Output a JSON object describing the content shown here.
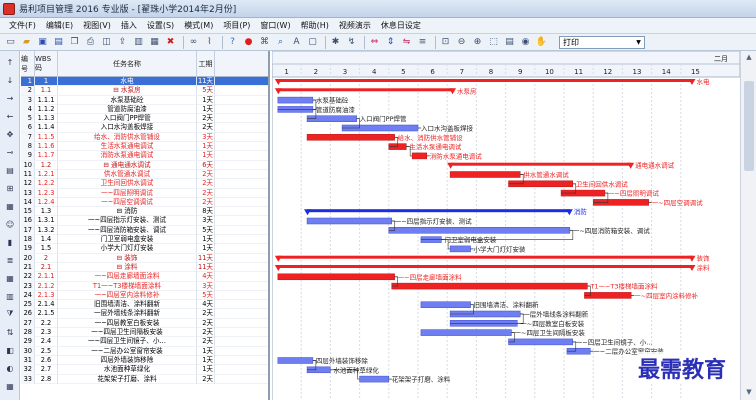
{
  "window": {
    "title": "易利项目管理 2016 专业版 - [翟珠小学2014年2月份]"
  },
  "menu": [
    "文件(F)",
    "编辑(E)",
    "视图(V)",
    "插入",
    "设置(S)",
    "模式(M)",
    "项目(P)",
    "窗口(W)",
    "帮助(H)",
    "视频演示",
    "休息日设定"
  ],
  "toolbar": {
    "icons": [
      "new-file-icon",
      "open-folder-icon",
      "save-icon",
      "save-as-icon",
      "copy-icon",
      "print-icon",
      "print-preview-icon",
      "export-icon",
      "document-icon",
      "page-icon",
      "delete-x-icon",
      "link-icon",
      "unlink-icon",
      "help-icon",
      "stop-icon",
      "network-icon",
      "search-icon",
      "text-a-icon",
      "text-frame-icon",
      "settings-icon",
      "link-arrow-icon",
      "indent-left-icon",
      "indent-mid-icon",
      "indent-right-icon",
      "outline-icon",
      "zoom-fit-icon",
      "zoom-out-icon",
      "zoom-in-icon",
      "select-area-icon",
      "page-view-icon",
      "eye-icon",
      "hand-pan-icon"
    ],
    "zoom_value": "打印"
  },
  "left_tools": [
    "arrow-up-icon",
    "arrow-down-icon",
    "indent-icon",
    "outdent-icon",
    "move-icon",
    "link-task-icon",
    "gantt-icon",
    "network-view-icon",
    "calendar-icon",
    "resource-icon",
    "chart-icon",
    "list-icon",
    "table-icon",
    "report-icon",
    "filter-icon",
    "sort-icon",
    "layer-icon",
    "color-icon",
    "grid-icon"
  ],
  "grid": {
    "headers": {
      "no": "编号",
      "wbs": "WBS码",
      "name": "任务名称",
      "duration": "工期"
    },
    "rows": [
      {
        "no": "1",
        "wbs": "1",
        "name": "水电",
        "dur": "11天",
        "tone": "sum",
        "selected": true
      },
      {
        "no": "2",
        "wbs": "1.1",
        "name": "⊟ 水泵房",
        "dur": "5天",
        "tone": "sum"
      },
      {
        "no": "3",
        "wbs": "1.1.1",
        "name": "水泵基础砼",
        "dur": "1天",
        "tone": "normal"
      },
      {
        "no": "4",
        "wbs": "1.1.2",
        "name": "管道防腐油漆",
        "dur": "1天",
        "tone": "normal"
      },
      {
        "no": "5",
        "wbs": "1.1.3",
        "name": "入口阀门PP焊管",
        "dur": "2天",
        "tone": "normal"
      },
      {
        "no": "6",
        "wbs": "1.1.4",
        "name": "入口水沟盖板焊接",
        "dur": "2天",
        "tone": "normal"
      },
      {
        "no": "7",
        "wbs": "1.1.5",
        "name": "给水、消防供水管铺设",
        "dur": "3天",
        "tone": "red"
      },
      {
        "no": "8",
        "wbs": "1.1.6",
        "name": "生活水泵通电调试",
        "dur": "1天",
        "tone": "red"
      },
      {
        "no": "9",
        "wbs": "1.1.7",
        "name": "消防水泵通电调试",
        "dur": "1天",
        "tone": "red"
      },
      {
        "no": "10",
        "wbs": "1.2",
        "name": "⊟ 通电通水调试",
        "dur": "6天",
        "tone": "sum"
      },
      {
        "no": "11",
        "wbs": "1.2.1",
        "name": "供水管通水调试",
        "dur": "2天",
        "tone": "red"
      },
      {
        "no": "12",
        "wbs": "1.2.2",
        "name": "卫生间回供水调试",
        "dur": "2天",
        "tone": "red"
      },
      {
        "no": "13",
        "wbs": "1.2.3",
        "name": "一~四层照明调试",
        "dur": "2天",
        "tone": "red"
      },
      {
        "no": "14",
        "wbs": "1.2.4",
        "name": "一~四层空调调试",
        "dur": "2天",
        "tone": "red"
      },
      {
        "no": "15",
        "wbs": "1.3",
        "name": "⊟ 消防",
        "dur": "8天",
        "tone": "normal"
      },
      {
        "no": "16",
        "wbs": "1.3.1",
        "name": "一~四层指示灯安装、测试",
        "dur": "3天",
        "tone": "normal"
      },
      {
        "no": "17",
        "wbs": "1.3.2",
        "name": "一~四层消防箱安装、调试",
        "dur": "5天",
        "tone": "normal"
      },
      {
        "no": "18",
        "wbs": "1.4",
        "name": "门卫室弱电盒安装",
        "dur": "1天",
        "tone": "normal"
      },
      {
        "no": "19",
        "wbs": "1.5",
        "name": "小学大门灯灯安装",
        "dur": "1天",
        "tone": "normal"
      },
      {
        "no": "20",
        "wbs": "2",
        "name": "⊟ 装饰",
        "dur": "11天",
        "tone": "sum"
      },
      {
        "no": "21",
        "wbs": "2.1",
        "name": "⊟ 涂料",
        "dur": "11天",
        "tone": "sum"
      },
      {
        "no": "22",
        "wbs": "2.1.1",
        "name": "一~四层走廊墙面涂料",
        "dur": "4天",
        "tone": "red"
      },
      {
        "no": "23",
        "wbs": "2.1.2",
        "name": "T1一~T3楼梯墙面涂料",
        "dur": "3天",
        "tone": "red"
      },
      {
        "no": "24",
        "wbs": "2.1.3",
        "name": "一~四层室内涂料修补",
        "dur": "5天",
        "tone": "red"
      },
      {
        "no": "25",
        "wbs": "2.1.4",
        "name": "旧围墙清洁、涂料翻新",
        "dur": "4天",
        "tone": "normal"
      },
      {
        "no": "26",
        "wbs": "2.1.5",
        "name": "一层外墙线条涂料翻新",
        "dur": "2天",
        "tone": "normal"
      },
      {
        "no": "27",
        "wbs": "2.2",
        "name": "一~四层教室白板安装",
        "dur": "2天",
        "tone": "normal"
      },
      {
        "no": "28",
        "wbs": "2.3",
        "name": "一~四层卫生间隔板安装",
        "dur": "2天",
        "tone": "normal"
      },
      {
        "no": "29",
        "wbs": "2.4",
        "name": "一~四层卫生间镜子、小…",
        "dur": "2天",
        "tone": "normal"
      },
      {
        "no": "30",
        "wbs": "2.5",
        "name": "一~二层办公室窗帘安装",
        "dur": "1天",
        "tone": "normal"
      },
      {
        "no": "31",
        "wbs": "2.6",
        "name": "四层外墙装饰移除",
        "dur": "1天",
        "tone": "normal"
      },
      {
        "no": "32",
        "wbs": "2.7",
        "name": "水池面种草绿化",
        "dur": "1天",
        "tone": "normal"
      },
      {
        "no": "33",
        "wbs": "2.8",
        "name": "花架架子打磨、涂料",
        "dur": "2天",
        "tone": "normal"
      }
    ]
  },
  "timeline": {
    "month": "二月",
    "days": [
      1,
      2,
      3,
      4,
      5,
      6,
      7,
      8,
      9,
      10,
      11,
      12,
      13,
      14,
      15
    ]
  },
  "gantt": {
    "bars": [
      {
        "row": 0,
        "start": 0.2,
        "end": 14.4,
        "kind": "sum-red",
        "label": "水电"
      },
      {
        "row": 1,
        "start": 0.2,
        "end": 6.2,
        "kind": "sum-red",
        "label": "水泵房"
      },
      {
        "row": 2,
        "start": 0.2,
        "end": 1.4,
        "kind": "blue",
        "label": "水泵基础砼"
      },
      {
        "row": 3,
        "start": 0.2,
        "end": 1.4,
        "kind": "blue",
        "label": "管道防腐油漆"
      },
      {
        "row": 4,
        "start": 1.2,
        "end": 2.9,
        "kind": "blue",
        "label": "入口阀门PP焊管"
      },
      {
        "row": 5,
        "start": 2.4,
        "end": 5.0,
        "kind": "blue",
        "label": "入口水沟盖板焊接"
      },
      {
        "row": 6,
        "start": 1.2,
        "end": 4.2,
        "kind": "red",
        "label": "给水、消防供水管铺设"
      },
      {
        "row": 7,
        "start": 4.0,
        "end": 4.6,
        "kind": "red",
        "label": "生活水泵通电调试"
      },
      {
        "row": 8,
        "start": 4.8,
        "end": 5.3,
        "kind": "red",
        "label": "消防水泵通电调试"
      },
      {
        "row": 9,
        "start": 6.1,
        "end": 12.3,
        "kind": "sum-red",
        "label": "通电通水调试"
      },
      {
        "row": 10,
        "start": 6.1,
        "end": 8.5,
        "kind": "red",
        "label": "供水管通水调试"
      },
      {
        "row": 11,
        "start": 8.1,
        "end": 10.3,
        "kind": "red",
        "label": "卫生间回供水调试"
      },
      {
        "row": 12,
        "start": 9.9,
        "end": 11.4,
        "kind": "red",
        "label": "一~四层照明调试"
      },
      {
        "row": 13,
        "start": 11.0,
        "end": 12.9,
        "kind": "red",
        "label": "一~四层空调调试"
      },
      {
        "row": 14,
        "start": 1.2,
        "end": 10.2,
        "kind": "sum-blue",
        "label": "消防"
      },
      {
        "row": 15,
        "start": 1.2,
        "end": 4.1,
        "kind": "blue",
        "label": "一~四层指示灯安装、测试"
      },
      {
        "row": 16,
        "start": 4.0,
        "end": 10.2,
        "kind": "blue",
        "label": "一~四层消防箱安装、调试"
      },
      {
        "row": 17,
        "start": 5.1,
        "end": 5.8,
        "kind": "blue",
        "label": "门卫室弱电盒安装"
      },
      {
        "row": 18,
        "start": 6.1,
        "end": 6.8,
        "kind": "blue",
        "label": "小学大门灯灯安装"
      },
      {
        "row": 19,
        "start": 0.2,
        "end": 14.4,
        "kind": "sum-red",
        "label": "装饰"
      },
      {
        "row": 20,
        "start": 0.2,
        "end": 14.4,
        "kind": "sum-red",
        "label": "涂料"
      },
      {
        "row": 21,
        "start": 0.2,
        "end": 4.2,
        "kind": "red",
        "label": "一~四层走廊墙面涂料"
      },
      {
        "row": 22,
        "start": 4.1,
        "end": 10.8,
        "kind": "red",
        "label": "T1一~T3楼梯墙面涂料"
      },
      {
        "row": 23,
        "start": 10.7,
        "end": 12.3,
        "kind": "red",
        "label": "一~四层室内涂料修补"
      },
      {
        "row": 24,
        "start": 5.1,
        "end": 6.8,
        "kind": "blue",
        "label": "旧围墙清洁、涂料翻新"
      },
      {
        "row": 25,
        "start": 6.1,
        "end": 8.5,
        "kind": "blue",
        "label": "一层外墙线条涂料翻新"
      },
      {
        "row": 26,
        "start": 6.1,
        "end": 8.4,
        "kind": "blue",
        "label": "一~四层教室白板安装"
      },
      {
        "row": 27,
        "start": 5.1,
        "end": 8.2,
        "kind": "blue",
        "label": "一~四层卫生间隔板安装"
      },
      {
        "row": 28,
        "start": 8.1,
        "end": 10.3,
        "kind": "blue",
        "label": "一~四层卫生间镜子、小…"
      },
      {
        "row": 29,
        "start": 10.1,
        "end": 10.9,
        "kind": "blue",
        "label": "一~二层办公室窗帘安装"
      },
      {
        "row": 30,
        "start": 0.2,
        "end": 1.4,
        "kind": "blue",
        "label": "四层外墙装饰移除"
      },
      {
        "row": 31,
        "start": 1.2,
        "end": 2.0,
        "kind": "blue",
        "label": "水池面种草绿化"
      },
      {
        "row": 32,
        "start": 3.0,
        "end": 4.0,
        "kind": "blue",
        "label": "花架架子打磨、涂料"
      }
    ]
  },
  "watermark": "最需教育",
  "colors": {
    "critical": "#ee2222",
    "normal": "#6f7ff2",
    "summary_blue": "#1c2ee0",
    "grid_line": "#9aa6b6"
  }
}
